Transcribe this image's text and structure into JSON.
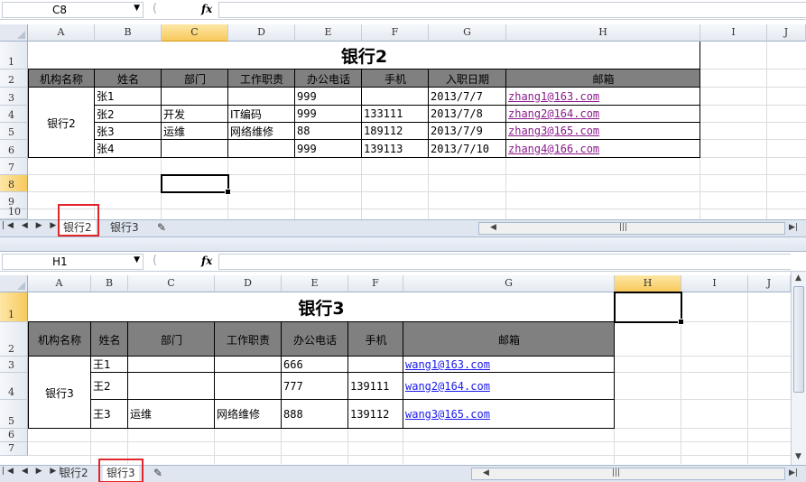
{
  "top": {
    "namebox": "C8",
    "fx": "fx",
    "columns": [
      "A",
      "B",
      "C",
      "D",
      "E",
      "F",
      "G",
      "H",
      "I",
      "J"
    ],
    "rows": [
      "1",
      "2",
      "3",
      "4",
      "5",
      "6",
      "7",
      "8",
      "9",
      "10"
    ],
    "title": "银行2",
    "headers": [
      "机构名称",
      "姓名",
      "部门",
      "工作职责",
      "办公电话",
      "手机",
      "入职日期",
      "邮箱"
    ],
    "org": "银行2",
    "data": [
      [
        "张1",
        "",
        "",
        "999",
        "",
        "2013/7/7",
        "zhang1@163.com"
      ],
      [
        "张2",
        "开发",
        "IT编码",
        "999",
        "133111",
        "2013/7/8",
        "zhang2@164.com"
      ],
      [
        "张3",
        "运维",
        "网络维修",
        "88",
        "189112",
        "2013/7/9",
        "zhang3@165.com"
      ],
      [
        "张4",
        "",
        "",
        "999",
        "139113",
        "2013/7/10",
        "zhang4@166.com"
      ]
    ],
    "tabs": [
      "银行2",
      "银行3"
    ],
    "active_tab": "银行2"
  },
  "bottom": {
    "namebox": "H1",
    "fx": "fx",
    "columns": [
      "A",
      "B",
      "C",
      "D",
      "E",
      "F",
      "G",
      "H",
      "I",
      "J"
    ],
    "rows": [
      "1",
      "2",
      "3",
      "4",
      "5",
      "6",
      "7"
    ],
    "title": "银行3",
    "headers": [
      "机构名称",
      "姓名",
      "部门",
      "工作职责",
      "办公电话",
      "手机",
      "邮箱"
    ],
    "org": "银行3",
    "data": [
      [
        "王1",
        "",
        "",
        "666",
        "",
        "wang1@163.com"
      ],
      [
        "王2",
        "",
        "",
        "777",
        "139111",
        "wang2@164.com"
      ],
      [
        "王3",
        "运维",
        "网络维修",
        "888",
        "139112",
        "wang3@165.com"
      ]
    ],
    "tabs": [
      "银行2",
      "银行3"
    ],
    "active_tab": "银行3"
  },
  "colors": {
    "header_fill": "#808080",
    "selected_header": "#f8c95c",
    "link_visited": "#8b1a8b",
    "link": "#1a1aee",
    "highlight_box": "#e0262a"
  }
}
